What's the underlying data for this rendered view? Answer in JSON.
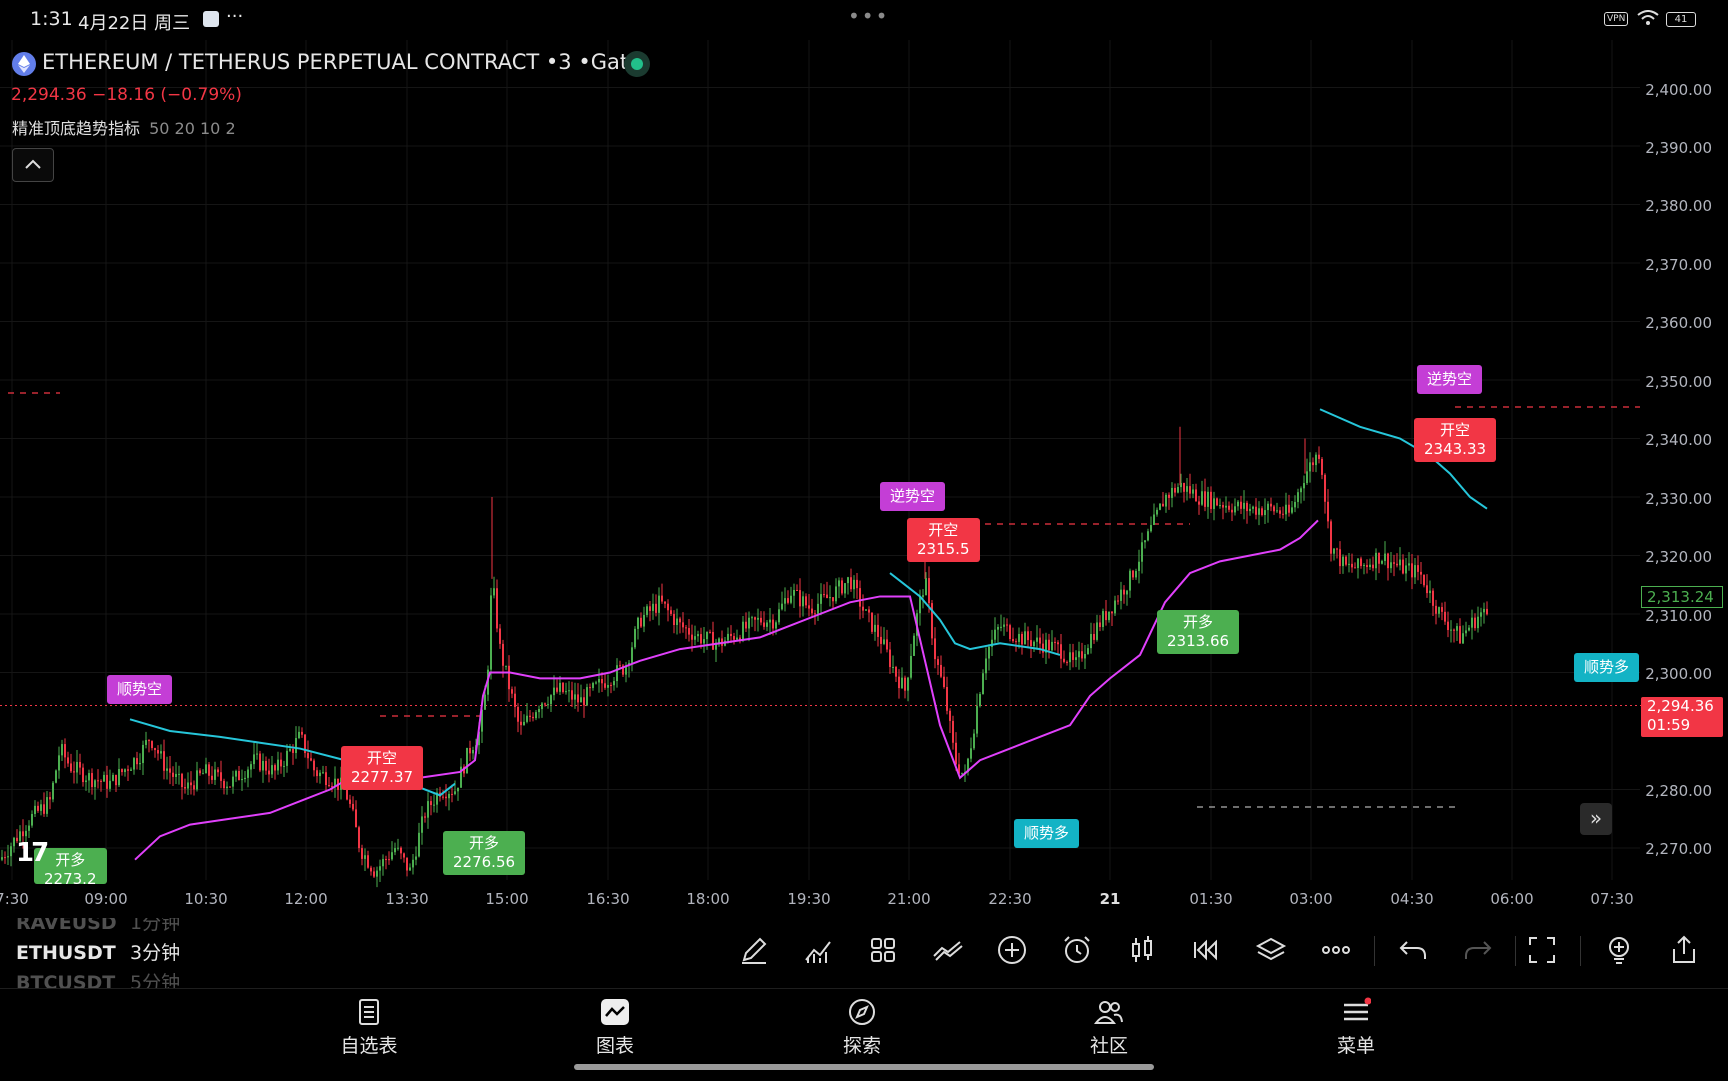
{
  "status_bar": {
    "time": "1:31",
    "date": "4月22日 周三",
    "more": "···",
    "center_dots": "•••",
    "vpn": "VPN",
    "battery": "41"
  },
  "symbol": {
    "title": "ETHEREUM / TETHERUS PERPETUAL CONTRACT •3 •Gate",
    "price_change": "2,294.36  −18.16 (−0.79%)",
    "indicator_name": "精准顶底趋势指标",
    "indicator_params": "50 20 10 2"
  },
  "colors": {
    "up": "#4caf50",
    "down": "#f23645",
    "trend_long": "#e040fb",
    "trend_short": "#26c6da",
    "background": "#000000"
  },
  "price_axis": {
    "labels": [
      "2,400.00",
      "2,390.00",
      "2,380.00",
      "2,370.00",
      "2,360.00",
      "2,350.00",
      "2,340.00",
      "2,330.00",
      "2,320.00",
      "2,310.00",
      "2,300.00",
      "2,280.00",
      "2,270.00"
    ],
    "last_price": "2,294.36",
    "countdown": "01:59",
    "ref_price": "2,313.24"
  },
  "time_axis": {
    "labels": [
      "7:30",
      "09:00",
      "10:30",
      "12:00",
      "13:30",
      "15:00",
      "16:30",
      "18:00",
      "19:30",
      "21:00",
      "22:30",
      "21",
      "01:30",
      "03:00",
      "04:30",
      "06:00",
      "07:30"
    ]
  },
  "signals": [
    {
      "kind": "顺势空",
      "color": "purple"
    },
    {
      "kind": "开空",
      "price": "2277.37",
      "color": "red"
    },
    {
      "kind": "开多",
      "price": "2276.56",
      "color": "green"
    },
    {
      "kind": "开多",
      "price": "2273.2",
      "color": "green"
    },
    {
      "kind": "逆势空",
      "color": "purple"
    },
    {
      "kind": "开空",
      "price": "2315.5",
      "color": "red"
    },
    {
      "kind": "顺势多",
      "color": "cyan"
    },
    {
      "kind": "开多",
      "price": "2313.66",
      "color": "green"
    },
    {
      "kind": "逆势空",
      "color": "purple"
    },
    {
      "kind": "开空",
      "price": "2343.33",
      "color": "red"
    },
    {
      "kind": "顺势多",
      "color": "cyan"
    }
  ],
  "chart_data": {
    "type": "candlestick",
    "symbol": "ETHUSDT",
    "interval": "3",
    "ylim": [
      2264,
      2404
    ],
    "y_ticks": [
      2400,
      2390,
      2380,
      2370,
      2360,
      2350,
      2340,
      2330,
      2320,
      2310,
      2300,
      2280,
      2270
    ],
    "x_ticks": [
      "7:30",
      "09:00",
      "10:30",
      "12:00",
      "13:30",
      "15:00",
      "16:30",
      "18:00",
      "19:30",
      "21:00",
      "22:30",
      "21",
      "01:30",
      "03:00",
      "04:30",
      "06:00",
      "07:30"
    ],
    "price_path": [
      [
        0,
        2268
      ],
      [
        30,
        2275
      ],
      [
        50,
        2278
      ],
      [
        60,
        2287
      ],
      [
        70,
        2284
      ],
      [
        90,
        2282
      ],
      [
        110,
        2281
      ],
      [
        140,
        2286
      ],
      [
        150,
        2289
      ],
      [
        165,
        2284
      ],
      [
        185,
        2280
      ],
      [
        205,
        2283
      ],
      [
        230,
        2281
      ],
      [
        255,
        2285
      ],
      [
        275,
        2283
      ],
      [
        300,
        2289
      ],
      [
        315,
        2283
      ],
      [
        330,
        2282
      ],
      [
        345,
        2280
      ],
      [
        352,
        2276
      ],
      [
        360,
        2270
      ],
      [
        375,
        2266
      ],
      [
        395,
        2270
      ],
      [
        410,
        2266
      ],
      [
        425,
        2276
      ],
      [
        440,
        2280
      ],
      [
        455,
        2280
      ],
      [
        470,
        2287
      ],
      [
        480,
        2290
      ],
      [
        487,
        2298
      ],
      [
        492,
        2316
      ],
      [
        500,
        2304
      ],
      [
        520,
        2290
      ],
      [
        540,
        2295
      ],
      [
        560,
        2297
      ],
      [
        580,
        2295
      ],
      [
        600,
        2298
      ],
      [
        625,
        2301
      ],
      [
        640,
        2309
      ],
      [
        660,
        2312
      ],
      [
        680,
        2308
      ],
      [
        700,
        2306
      ],
      [
        720,
        2305
      ],
      [
        740,
        2307
      ],
      [
        760,
        2309
      ],
      [
        775,
        2309
      ],
      [
        790,
        2314
      ],
      [
        810,
        2311
      ],
      [
        830,
        2313
      ],
      [
        850,
        2316
      ],
      [
        865,
        2310
      ],
      [
        880,
        2306
      ],
      [
        895,
        2300
      ],
      [
        905,
        2297
      ],
      [
        915,
        2308
      ],
      [
        925,
        2316
      ],
      [
        935,
        2303
      ],
      [
        945,
        2296
      ],
      [
        955,
        2285
      ],
      [
        965,
        2282
      ],
      [
        975,
        2292
      ],
      [
        985,
        2303
      ],
      [
        1000,
        2308
      ],
      [
        1020,
        2306
      ],
      [
        1040,
        2305
      ],
      [
        1060,
        2304
      ],
      [
        1075,
        2301
      ],
      [
        1090,
        2306
      ],
      [
        1110,
        2311
      ],
      [
        1130,
        2316
      ],
      [
        1150,
        2324
      ],
      [
        1165,
        2330
      ],
      [
        1180,
        2332
      ],
      [
        1200,
        2330
      ],
      [
        1220,
        2329
      ],
      [
        1245,
        2328
      ],
      [
        1270,
        2328
      ],
      [
        1290,
        2327
      ],
      [
        1305,
        2334
      ],
      [
        1320,
        2338
      ],
      [
        1330,
        2322
      ],
      [
        1345,
        2318
      ],
      [
        1360,
        2318
      ],
      [
        1380,
        2320
      ],
      [
        1400,
        2318
      ],
      [
        1420,
        2317
      ],
      [
        1440,
        2310
      ],
      [
        1460,
        2306
      ],
      [
        1480,
        2310
      ],
      [
        1487,
        2310
      ]
    ],
    "series": [
      {
        "name": "trend_long",
        "color": "#e040fb",
        "points": [
          [
            135,
            2268
          ],
          [
            160,
            2272
          ],
          [
            190,
            2274
          ],
          [
            230,
            2275
          ],
          [
            270,
            2276
          ],
          [
            300,
            2278
          ],
          [
            330,
            2280
          ],
          [
            350,
            2282
          ],
          [
            380,
            2281
          ],
          [
            420,
            2282
          ],
          [
            460,
            2283
          ],
          [
            475,
            2285
          ],
          [
            483,
            2296
          ],
          [
            490,
            2300
          ],
          [
            510,
            2300
          ],
          [
            540,
            2299
          ],
          [
            580,
            2299
          ],
          [
            610,
            2300
          ],
          [
            640,
            2302
          ],
          [
            680,
            2304
          ],
          [
            720,
            2305
          ],
          [
            760,
            2306
          ],
          [
            790,
            2308
          ],
          [
            820,
            2310
          ],
          [
            850,
            2312
          ],
          [
            880,
            2313
          ],
          [
            910,
            2313
          ],
          [
            940,
            2291
          ],
          [
            960,
            2282
          ],
          [
            980,
            2285
          ],
          [
            1010,
            2287
          ],
          [
            1040,
            2289
          ],
          [
            1070,
            2291
          ],
          [
            1090,
            2296
          ],
          [
            1110,
            2299
          ],
          [
            1140,
            2303
          ],
          [
            1165,
            2312
          ],
          [
            1190,
            2317
          ],
          [
            1220,
            2319
          ],
          [
            1250,
            2320
          ],
          [
            1280,
            2321
          ],
          [
            1300,
            2323
          ],
          [
            1318,
            2326
          ]
        ]
      },
      {
        "name": "trend_short",
        "color": "#26c6da",
        "points": [
          [
            130,
            2292
          ],
          [
            170,
            2290
          ],
          [
            220,
            2289
          ],
          [
            260,
            2288
          ],
          [
            300,
            2287
          ],
          [
            345,
            2285
          ],
          [
            380,
            2283
          ],
          [
            410,
            2281
          ],
          [
            440,
            2279
          ],
          [
            455,
            2281
          ],
          [
            890,
            2317
          ],
          [
            920,
            2313
          ],
          [
            940,
            2309
          ],
          [
            955,
            2305
          ],
          [
            970,
            2304
          ],
          [
            1000,
            2305
          ],
          [
            1040,
            2304
          ],
          [
            1060,
            2303
          ],
          [
            1320,
            2345
          ],
          [
            1360,
            2342
          ],
          [
            1400,
            2340
          ],
          [
            1430,
            2337
          ],
          [
            1450,
            2334
          ],
          [
            1470,
            2330
          ],
          [
            1487,
            2328
          ]
        ]
      }
    ]
  },
  "bottom_toolbar": {
    "intervals": [
      {
        "sym": "RAVEUSD",
        "per": "1分钟",
        "faded": true
      },
      {
        "sym": "ETHUSDT",
        "per": "3分钟",
        "faded": false
      },
      {
        "sym": "BTCUSDT",
        "per": "5分钟",
        "faded": true
      }
    ]
  },
  "tabs": [
    "自选表",
    "图表",
    "探索",
    "社区",
    "菜单"
  ]
}
